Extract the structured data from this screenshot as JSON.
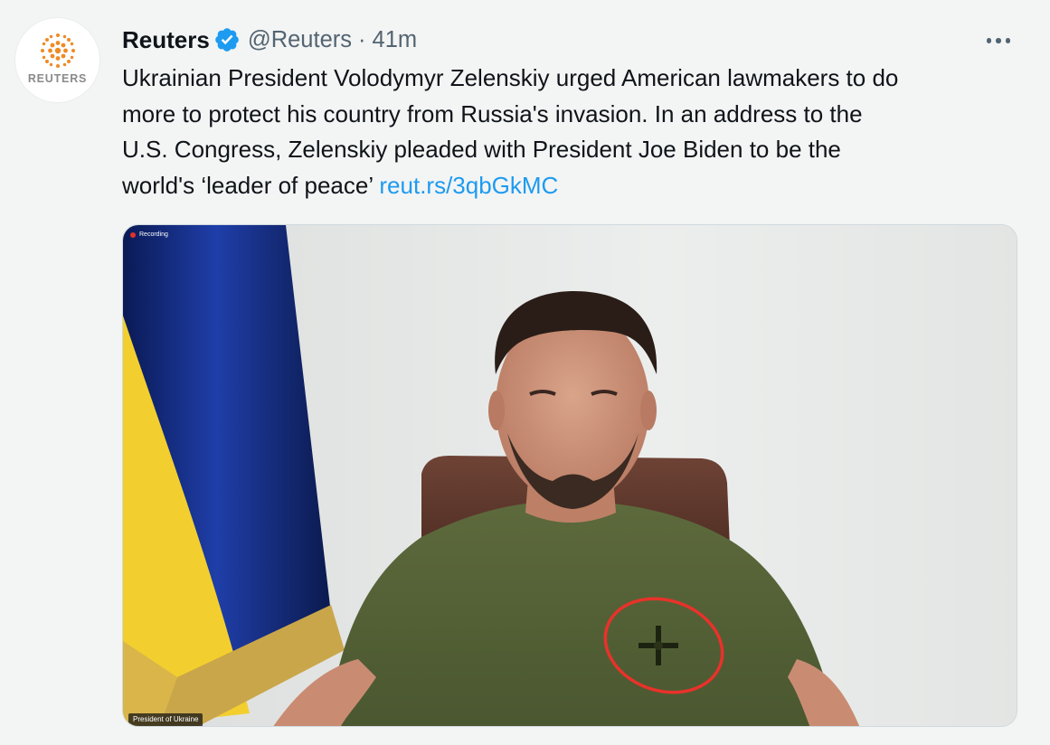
{
  "tweet": {
    "author": {
      "name": "Reuters",
      "handle": "@Reuters",
      "avatar_text": "REUTERS",
      "verified_icon": "verified-badge-icon"
    },
    "separator": "·",
    "time": "41m",
    "more_icon": "more-options-icon",
    "text": {
      "line1": "Ukrainian President Volodymyr Zelenskiy urged American lawmakers to do",
      "line2": "more to protect his country from Russia's invasion. In an address to the",
      "line3": "U.S. Congress, Zelenskiy pleaded with President Joe Biden to be the",
      "line4": "world's ‘leader of peace’",
      "link": "reut.rs/3qbGkMC"
    },
    "media": {
      "recording_label": "Recording",
      "caption_label": "President of Ukraine"
    }
  },
  "colors": {
    "background": "#f3f4f4",
    "link": "#1d9bf0",
    "verified": "#1d9bf0",
    "secondary_text": "#536471",
    "annotation_circle": "#e8322a",
    "reuters_orange": "#f08a24"
  }
}
